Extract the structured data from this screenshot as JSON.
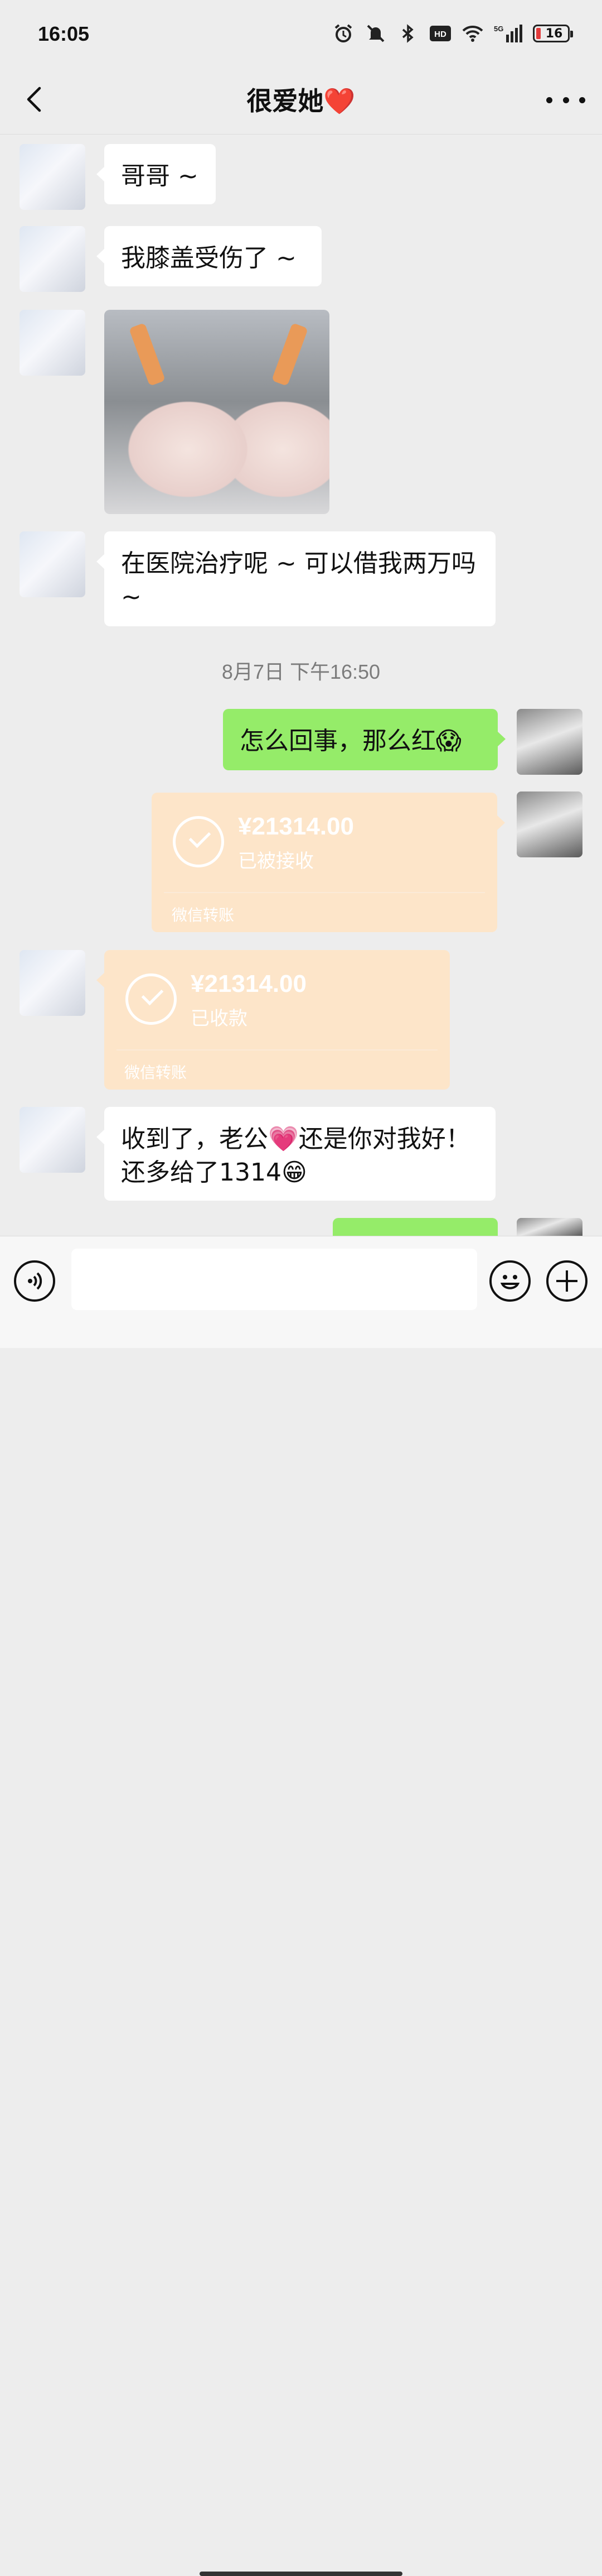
{
  "status_bar": {
    "time": "16:05",
    "network": "5G",
    "battery_level": "16",
    "icons": [
      "alarm-icon",
      "mute-icon",
      "bluetooth-icon",
      "hd-icon",
      "wifi-icon",
      "signal-icon",
      "battery-icon"
    ]
  },
  "header": {
    "title": "很爱她",
    "title_emoji": "❤️",
    "back_icon": "chevron-left-icon",
    "more_icon": "more-dots-icon"
  },
  "messages": [
    {
      "from": "her",
      "type": "text",
      "text": "哥哥 ~"
    },
    {
      "from": "her",
      "type": "text",
      "text": "我膝盖受伤了 ~"
    },
    {
      "from": "her",
      "type": "image"
    },
    {
      "from": "her",
      "type": "text",
      "text": "在医院治疗呢 ~ 可以借我两万吗 ~"
    },
    {
      "from": "me",
      "type": "text",
      "text": "怎么回事，那么红😱"
    },
    {
      "from": "me",
      "type": "transfer",
      "amount": "¥21314.00",
      "status": "已被接收",
      "label": "微信转账"
    },
    {
      "from": "her",
      "type": "transfer",
      "amount": "¥21314.00",
      "status": "已收款",
      "label": "微信转账"
    },
    {
      "from": "her",
      "type": "text",
      "text": "收到了，老公💗还是你对我好！还多给了1314😁"
    }
  ],
  "timestamp": "8月7日 下午16:50",
  "colors": {
    "background": "#ededed",
    "my_bubble": "#95ec69",
    "her_bubble": "#ffffff",
    "transfer_done": "#fde5c9"
  },
  "input_bar": {
    "voice_icon": "voice-icon",
    "emoji_icon": "emoji-icon",
    "plus_icon": "plus-icon",
    "placeholder": ""
  }
}
